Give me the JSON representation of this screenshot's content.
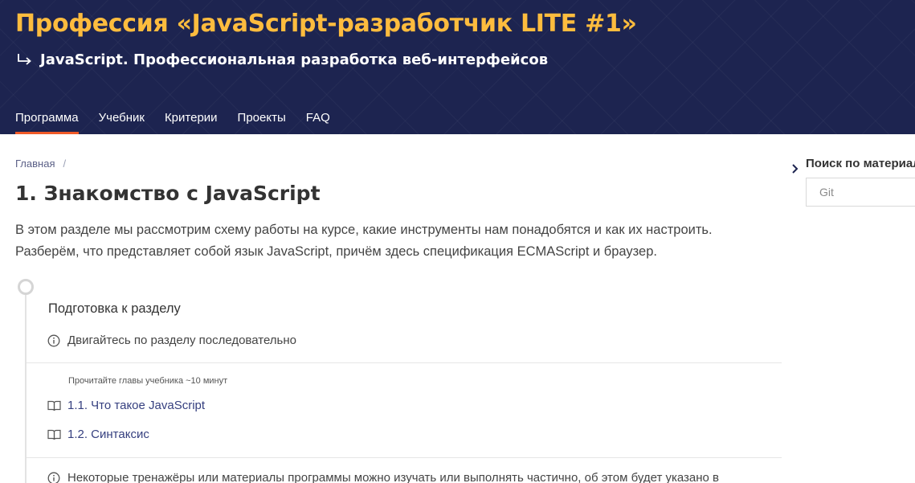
{
  "header": {
    "profession_title": "Профессия «JavaScript-разработчик LITE #1»",
    "course_title": "JavaScript. Профессиональная разработка веб-интерфейсов",
    "accent_color": "#fdbc3e",
    "background_color": "#1d2450"
  },
  "nav": {
    "tabs": [
      {
        "label": "Программа",
        "active": true
      },
      {
        "label": "Учебник",
        "active": false
      },
      {
        "label": "Критерии",
        "active": false
      },
      {
        "label": "Проекты",
        "active": false
      },
      {
        "label": "FAQ",
        "active": false
      }
    ],
    "active_underline_color": "#f05a28"
  },
  "breadcrumb": {
    "home": "Главная",
    "separator": "/"
  },
  "page": {
    "title": "1. Знакомство с JavaScript",
    "intro_line1": "В этом разделе мы рассмотрим схему работы на курсе, какие инструменты нам понадобятся и как их настроить.",
    "intro_line2": "Разберём, что представляет собой язык JavaScript, причём здесь спецификация ECMAScript и браузер."
  },
  "section": {
    "heading": "Подготовка к разделу",
    "notice_sequence": "Двигайтесь по разделу последовательно",
    "reading_label": "Прочитайте главы учебника  ~10 минут",
    "chapters": [
      {
        "label": "1.1. Что такое JavaScript"
      },
      {
        "label": "1.2. Синтаксис"
      }
    ],
    "notice_partial": "Некоторые тренажёры или материалы программы можно изучать или выполнять частично, об этом будет указано в"
  },
  "sidebar": {
    "search_title": "Поиск по материалам",
    "search_placeholder": "Git",
    "search_value": ""
  },
  "icons": {
    "subtitle_arrow": "return-arrow-icon",
    "notice": "info-icon",
    "chapter": "book-icon",
    "sidebar_toggle": "chevron-right-icon"
  }
}
